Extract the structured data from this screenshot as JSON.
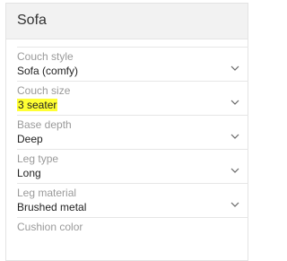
{
  "header": {
    "title": "Sofa"
  },
  "fields": [
    {
      "label": "Couch style",
      "value": "Sofa (comfy)",
      "highlighted": false,
      "has_dropdown": true
    },
    {
      "label": "Couch size",
      "value": "3 seater",
      "highlighted": true,
      "has_dropdown": true
    },
    {
      "label": "Base depth",
      "value": "Deep",
      "highlighted": false,
      "has_dropdown": true
    },
    {
      "label": "Leg type",
      "value": "Long",
      "highlighted": false,
      "has_dropdown": true
    },
    {
      "label": "Leg material",
      "value": "Brushed metal",
      "highlighted": false,
      "has_dropdown": true
    },
    {
      "label": "Cushion color",
      "value": "",
      "highlighted": false,
      "has_dropdown": false
    }
  ],
  "colors": {
    "highlight": "#ffff33",
    "label": "#9a9a9a",
    "value": "#222222",
    "header_bg": "#f2f2f2"
  }
}
